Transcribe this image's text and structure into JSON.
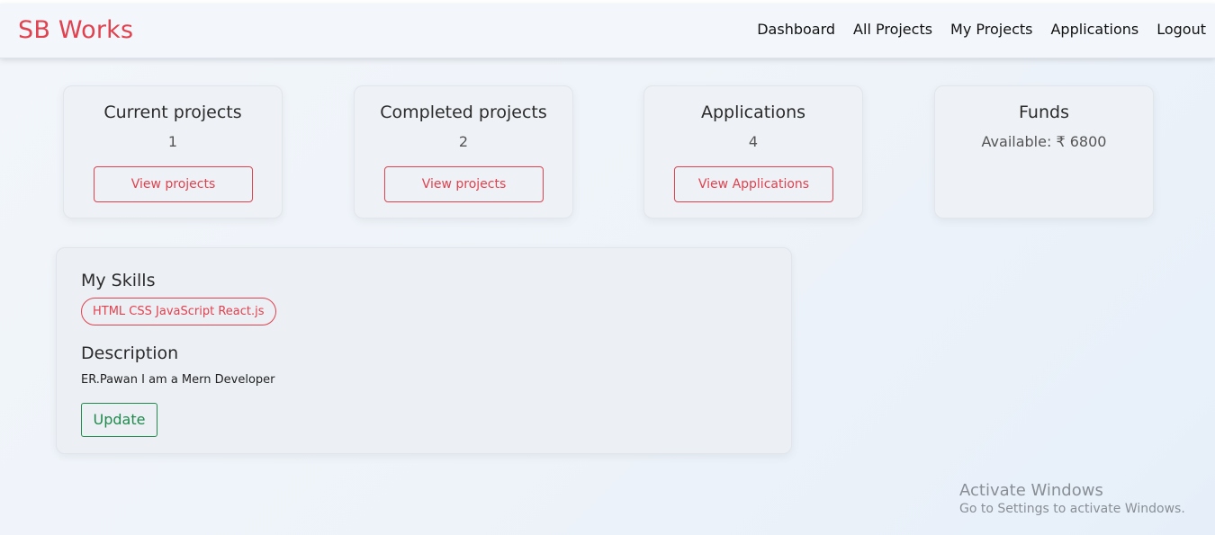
{
  "navbar": {
    "brand": "SB Works",
    "links": [
      "Dashboard",
      "All Projects",
      "My Projects",
      "Applications",
      "Logout"
    ]
  },
  "cards": [
    {
      "title": "Current projects",
      "value": "1",
      "button": "View projects"
    },
    {
      "title": "Completed projects",
      "value": "2",
      "button": "View projects"
    },
    {
      "title": "Applications",
      "value": "4",
      "button": "View Applications"
    },
    {
      "title": "Funds",
      "value": "Available: ₹ 6800"
    }
  ],
  "profile": {
    "skills_title": "My Skills",
    "skills": "HTML CSS JavaScript React.js",
    "description_title": "Description",
    "description": "ER.Pawan I am a Mern Developer",
    "update_button": "Update"
  },
  "watermark": {
    "title": "Activate Windows",
    "subtitle": "Go to Settings to activate Windows."
  },
  "colors": {
    "brand": "#e0424f",
    "accent_red": "#e0424f",
    "accent_green": "#1f8a4c"
  }
}
